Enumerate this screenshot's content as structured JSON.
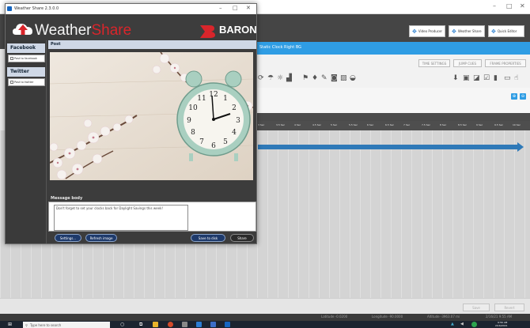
{
  "background_app": {
    "top_buttons": [
      {
        "label": "Video Producer",
        "icon": "move-arrows-icon"
      },
      {
        "label": "Weather Share",
        "icon": "move-arrows-icon"
      },
      {
        "label": "Quick Editor",
        "icon": "move-arrows-icon"
      }
    ],
    "project_title": "Static Clock Right BG",
    "settings_buttons": [
      "TIME SETTINGS",
      "JUMP CUES",
      "FRAME PROPERTIES"
    ],
    "ruler_ticks": [
      "3 Sec",
      "3.5 Sec",
      "4 Sec",
      "4.5 Sec",
      "5 Sec",
      "5.5 Sec",
      "6 Sec",
      "6.5 Sec",
      "7 Sec",
      "7.5 Sec",
      "8 Sec",
      "8.5 Sec",
      "9 Sec",
      "9.5 Sec",
      "10 Sec"
    ],
    "bottom_buttons": [
      "Save",
      "Revert"
    ],
    "status": {
      "latitude": "Latitude -0.0200",
      "longitude": "Longitude -90.0000",
      "altitude": "Altitude -3963.07 mi",
      "datetime": "2/16/21 9:55 AM"
    }
  },
  "dialog": {
    "window_title": "Weather Share 2.3.0.0",
    "window_controls": [
      "–",
      "□",
      "✕"
    ],
    "logo_weather": "Weather",
    "logo_share": "Share",
    "brand": "BARON",
    "sidebar": [
      {
        "header": "Facebook",
        "button": "Post to facebook"
      },
      {
        "header": "Twitter",
        "button": "Post to twitter"
      }
    ],
    "post_header": "Post",
    "message_label": "Message body",
    "message_text": "Don't forget to set your clocks back for Daylight Savings this week!",
    "buttons": {
      "settings": "Settings...",
      "refresh": "Refresh image",
      "save": "Save to disk",
      "share": "Share"
    }
  },
  "taskbar": {
    "search_placeholder": "Type here to search",
    "time": "9:56 AM",
    "date": "2/16/2021"
  },
  "colors": {
    "accent_blue": "#2f9de4",
    "brand_red": "#d9252b",
    "dialog_bg": "#3c3c3c",
    "timeline_track": "#2e79b8"
  }
}
